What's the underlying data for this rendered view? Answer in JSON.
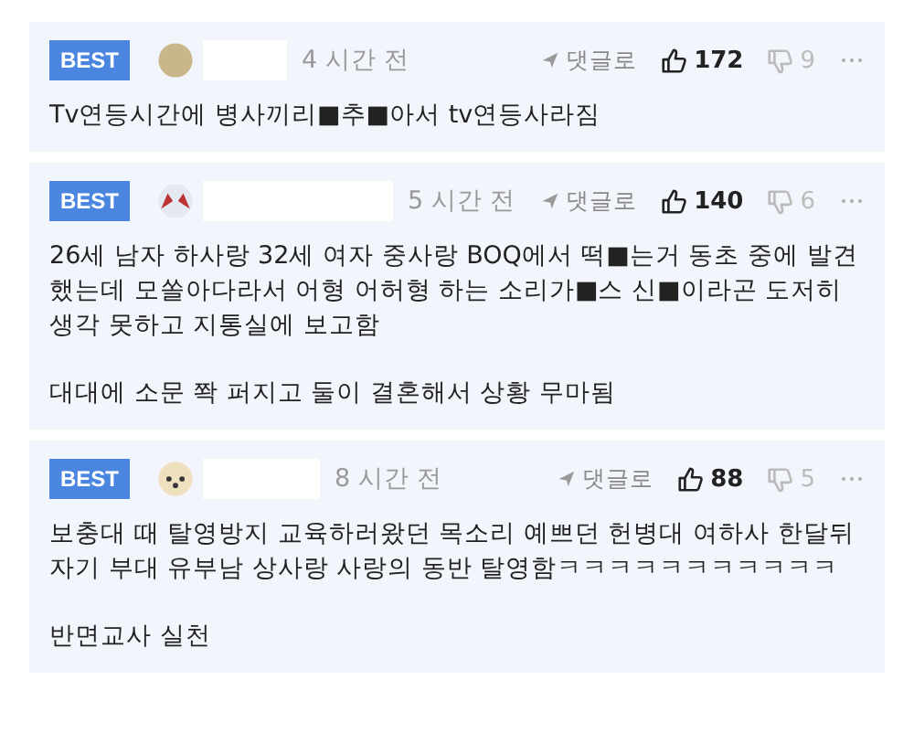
{
  "comments": [
    {
      "badge": "BEST",
      "kind": "tan",
      "time": "4 시간 전",
      "reply_label": "댓글로",
      "likes": "172",
      "dislikes": "9",
      "paragraphs": [
        "Tv연등시간에 병사끼리■추■아서 tv연등사라짐"
      ]
    },
    {
      "badge": "BEST",
      "kind": "white",
      "time": "5 시간 전",
      "reply_label": "댓글로",
      "likes": "140",
      "dislikes": "6",
      "paragraphs": [
        "26세 남자 하사랑 32세 여자 중사랑 BOQ에서 떡■는거 동초 중에 발견했는데 모쏠아다라서 어형 어허형 하는 소리가■스 신■이라곤 도저히 생각 못하고 지통실에 보고함",
        "대대에 소문 쫙 퍼지고 둘이 결혼해서 상황 무마됨"
      ]
    },
    {
      "badge": "BEST",
      "kind": "dog",
      "time": "8 시간 전",
      "reply_label": "댓글로",
      "likes": "88",
      "dislikes": "5",
      "paragraphs": [
        "보충대 때 탈영방지 교육하러왔던 목소리 예쁘던 헌병대 여하사 한달뒤 자기 부대 유부남 상사랑 사랑의 동반 탈영함ㅋㅋㅋㅋㅋㅋㅋㅋㅋㅋㅋ",
        "반면교사 실천"
      ]
    }
  ]
}
